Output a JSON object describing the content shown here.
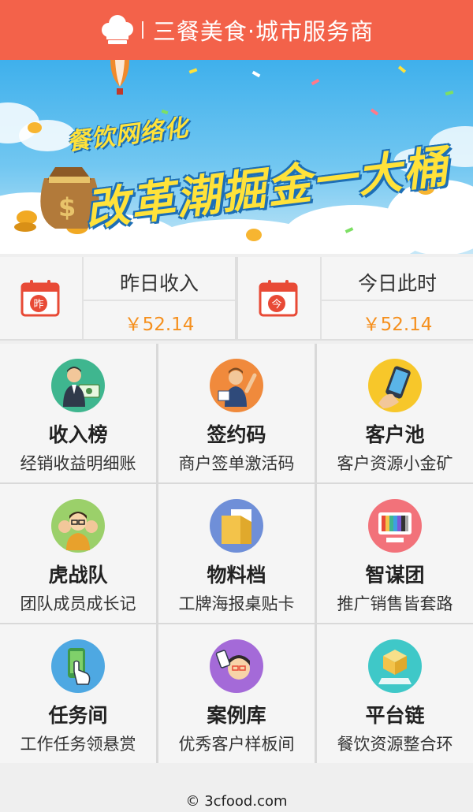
{
  "header": {
    "title": "三餐美食·城市服务商"
  },
  "banner": {
    "line1": "餐饮网络化",
    "line2": "改革潮掘金一大桶"
  },
  "stats": [
    {
      "icon_char": "昨",
      "label": "昨日收入",
      "value": "￥52.14"
    },
    {
      "icon_char": "今",
      "label": "今日此时",
      "value": "￥52.14"
    }
  ],
  "grid": [
    {
      "name": "收入榜",
      "desc": "经销收益明细账",
      "icon": "earnings-icon"
    },
    {
      "name": "签约码",
      "desc": "商户签单激活码",
      "icon": "signing-icon"
    },
    {
      "name": "客户池",
      "desc": "客户资源小金矿",
      "icon": "phone-icon"
    },
    {
      "name": "虎战队",
      "desc": "团队成员成长记",
      "icon": "team-icon"
    },
    {
      "name": "物料档",
      "desc": "工牌海报桌贴卡",
      "icon": "folder-icon"
    },
    {
      "name": "智谋团",
      "desc": "推广销售皆套路",
      "icon": "monitor-icon"
    },
    {
      "name": "任务间",
      "desc": "工作任务领悬赏",
      "icon": "touch-phone-icon"
    },
    {
      "name": "案例库",
      "desc": "优秀客户样板间",
      "icon": "showcase-icon"
    },
    {
      "name": "平台链",
      "desc": "餐饮资源整合环",
      "icon": "cube-icon"
    }
  ],
  "footer": {
    "copyright": "© 3cfood.com"
  },
  "colors": {
    "brand": "#f3624a",
    "money": "#f5901e",
    "calendar": "#e84a36"
  }
}
